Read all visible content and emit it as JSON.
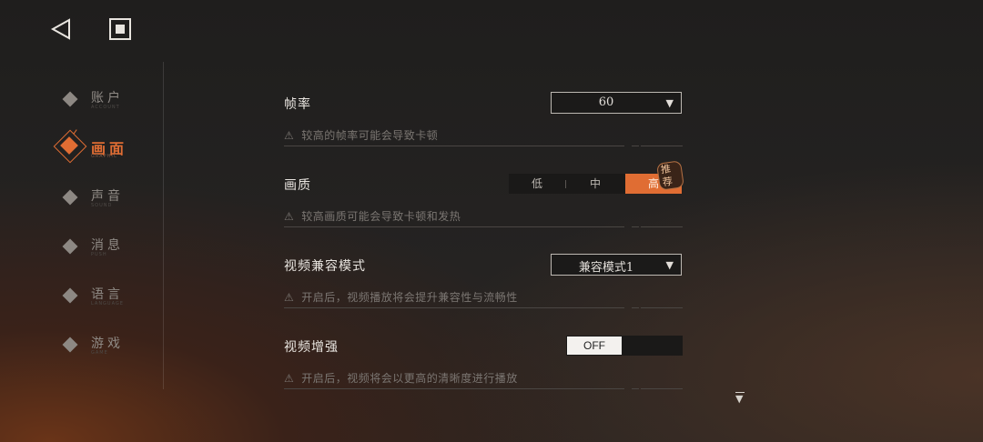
{
  "nav": [
    {
      "label": "账户",
      "sub": "ACCOUNT"
    },
    {
      "label": "画面",
      "sub": "GRAPHIC"
    },
    {
      "label": "声音",
      "sub": "SOUND"
    },
    {
      "label": "消息",
      "sub": "PUSH"
    },
    {
      "label": "语言",
      "sub": "LANGUAGE"
    },
    {
      "label": "游戏",
      "sub": "GAME"
    }
  ],
  "settings": {
    "fps": {
      "title": "帧率",
      "value": "60",
      "hint": "较高的帧率可能会导致卡顿"
    },
    "quality": {
      "title": "画质",
      "options": [
        "低",
        "中",
        "高"
      ],
      "selected": "高",
      "badge": "推荐",
      "hint": "较高画质可能会导致卡顿和发热"
    },
    "compat": {
      "title": "视频兼容模式",
      "value": "兼容模式1",
      "hint": "开启后，视频播放将会提升兼容性与流畅性"
    },
    "enhance": {
      "title": "视频增强",
      "value": "OFF",
      "hint": "开启后，视频将会以更高的清晰度进行播放"
    }
  },
  "icons": {
    "back": "back-triangle-icon",
    "stop": "stop-square-icon",
    "hint": "warning-icon",
    "dropdown": "caret-down-icon",
    "scroll": "scroll-down-icon"
  },
  "colors": {
    "accent": "#e06d33"
  }
}
